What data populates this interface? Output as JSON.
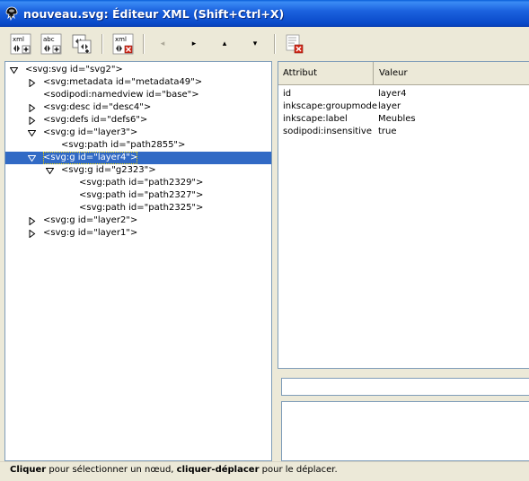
{
  "window": {
    "title": "nouveau.svg: Éditeur XML (Shift+Ctrl+X)"
  },
  "toolbar": {
    "new_element_node_text": "xml",
    "new_text_node_text": "abc",
    "delete_node_text": "xml",
    "unindent": "◂",
    "indent": "▸",
    "raise": "▴",
    "lower": "▾"
  },
  "tree": {
    "nodes": [
      {
        "label": "<svg:svg id=\"svg2\">",
        "expander": "expanded"
      },
      {
        "label": "<svg:metadata id=\"metadata49\">",
        "expander": "collapsed"
      },
      {
        "label": "<sodipodi:namedview id=\"base\">",
        "expander": "none"
      },
      {
        "label": "<svg:desc id=\"desc4\">",
        "expander": "collapsed"
      },
      {
        "label": "<svg:defs id=\"defs6\">",
        "expander": "collapsed"
      },
      {
        "label": "<svg:g id=\"layer3\">",
        "expander": "expanded"
      },
      {
        "label": "<svg:path id=\"path2855\">",
        "expander": "none"
      },
      {
        "label": "<svg:g id=\"layer4\">",
        "expander": "expanded",
        "selected": true
      },
      {
        "label": "<svg:g id=\"g2323\">",
        "expander": "expanded"
      },
      {
        "label": "<svg:path id=\"path2329\">",
        "expander": "none"
      },
      {
        "label": "<svg:path id=\"path2327\">",
        "expander": "none"
      },
      {
        "label": "<svg:path id=\"path2325\">",
        "expander": "none"
      },
      {
        "label": "<svg:g id=\"layer2\">",
        "expander": "collapsed"
      },
      {
        "label": "<svg:g id=\"layer1\">",
        "expander": "collapsed"
      }
    ]
  },
  "attributes": {
    "header_name": "Attribut",
    "header_value": "Valeur",
    "rows": [
      {
        "name": "id",
        "value": "layer4"
      },
      {
        "name": "inkscape:groupmode",
        "value": "layer"
      },
      {
        "name": "inkscape:label",
        "value": "Meubles"
      },
      {
        "name": "sodipodi:insensitive",
        "value": "true"
      }
    ]
  },
  "attribute_editor": {
    "name_value": "",
    "value_text": ""
  },
  "statusbar": {
    "part1_bold": "Cliquer",
    "part2": " pour sélectionner un nœud, ",
    "part3_bold": "cliquer-déplacer",
    "part4": " pour le déplacer."
  }
}
